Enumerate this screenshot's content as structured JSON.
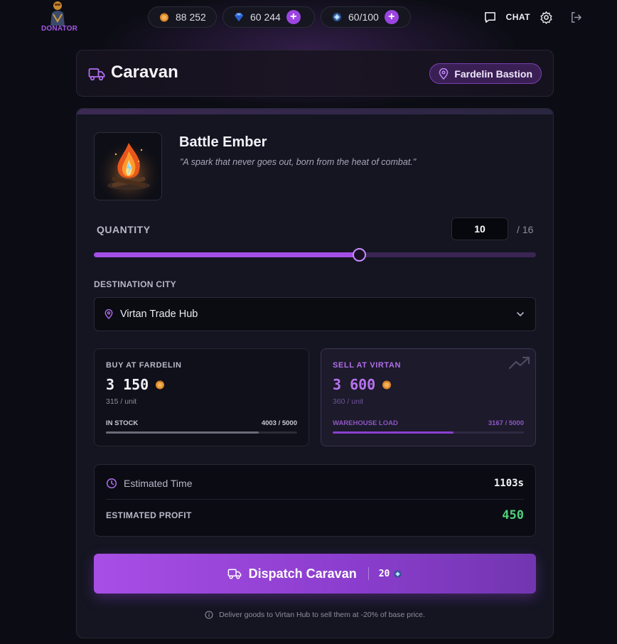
{
  "topbar": {
    "logo_label": "DONATOR",
    "gold": "88 252",
    "gems": "60 244",
    "energy": "60/100",
    "chat_label": "CHAT"
  },
  "header": {
    "title": "Caravan",
    "location": "Fardelin Bastion"
  },
  "item": {
    "name": "Battle Ember",
    "description": "\"A spark that never goes out, born from the heat of combat.\""
  },
  "quantity": {
    "label": "QUANTITY",
    "value": "10",
    "max_label": "/ 16",
    "fraction": 0.6
  },
  "destination": {
    "label": "DESTINATION CITY",
    "selected": "Virtan Trade Hub"
  },
  "buy": {
    "label": "BUY AT FARDELIN",
    "amount": "3 150",
    "unit": "315 / unit",
    "bar_label": "IN STOCK",
    "bar_value": "4003 / 5000",
    "fraction": 0.8
  },
  "sell": {
    "label": "SELL AT VIRTAN",
    "amount": "3 600",
    "unit": "360 / unit",
    "bar_label": "WAREHOUSE LOAD",
    "bar_value": "3167 / 5000",
    "fraction": 0.633
  },
  "estimate": {
    "time_label": "Estimated Time",
    "time_value": "1103s",
    "profit_label": "ESTIMATED PROFIT",
    "profit_value": "450"
  },
  "dispatch": {
    "label": "Dispatch Caravan",
    "cost": "20"
  },
  "footnote": "Deliver goods to Virtan Hub to sell them at -20% of base price.",
  "colors": {
    "accent": "#a34ee6",
    "profit": "#4fd07a",
    "background": "#0c0d14"
  }
}
